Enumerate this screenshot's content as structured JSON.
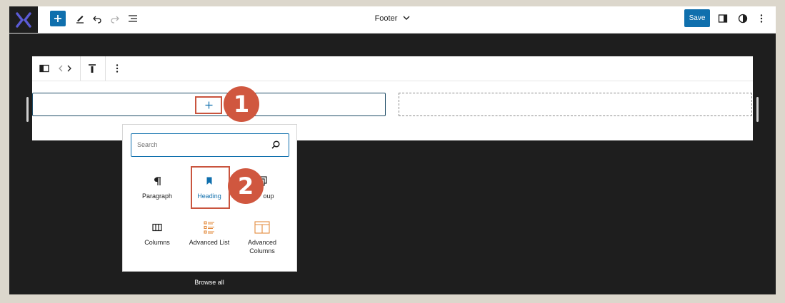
{
  "toolbar": {
    "document_title": "Footer",
    "save_label": "Save"
  },
  "inserter": {
    "search_placeholder": "Search",
    "blocks": [
      {
        "label": "Paragraph",
        "icon": "paragraph-icon"
      },
      {
        "label": "Heading",
        "icon": "bookmark-icon"
      },
      {
        "label": "Group",
        "icon": "group-icon",
        "visible_label": "oup"
      },
      {
        "label": "Columns",
        "icon": "columns-icon"
      },
      {
        "label": "Advanced List",
        "icon": "advanced-list-icon"
      },
      {
        "label": "Advanced Columns",
        "label_line1": "Advanced",
        "label_line2": "Columns",
        "icon": "advanced-columns-icon"
      }
    ],
    "browse_all": "Browse all"
  },
  "annotations": {
    "step1": "1",
    "step2": "2"
  },
  "colors": {
    "accent": "#0f6fad",
    "highlight": "#c9543e",
    "badge": "#d0573f",
    "dark": "#1e1e1e",
    "orange_icon": "#e38b3e"
  }
}
